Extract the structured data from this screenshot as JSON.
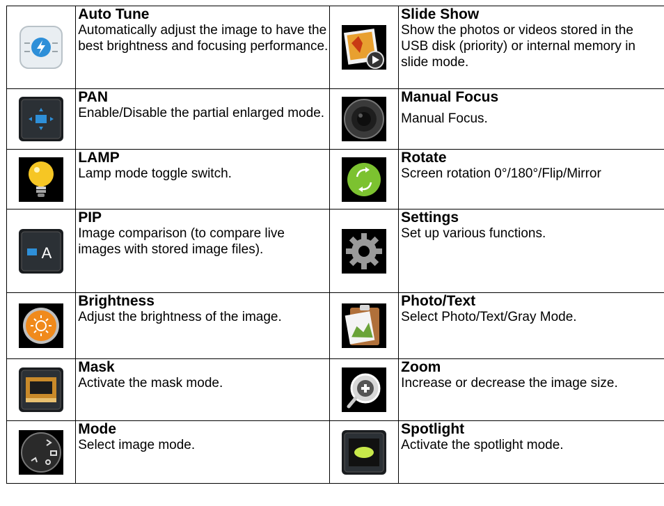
{
  "rows": [
    {
      "left": {
        "icon": "auto-tune-icon",
        "title": "Auto Tune",
        "desc": "Automatically adjust the image to have the best brightness and focusing performance."
      },
      "right": {
        "icon": "slide-show-icon",
        "title": "Slide Show",
        "desc": "Show the photos or videos stored in the USB disk (priority) or internal memory in slide mode."
      }
    },
    {
      "left": {
        "icon": "pan-icon",
        "title": "PAN",
        "desc": "Enable/Disable the partial enlarged mode."
      },
      "right": {
        "icon": "manual-focus-icon",
        "title": "Manual Focus",
        "desc": "Manual Focus."
      }
    },
    {
      "left": {
        "icon": "lamp-icon",
        "title": "LAMP",
        "desc": "Lamp mode toggle switch."
      },
      "right": {
        "icon": "rotate-icon",
        "title": "Rotate",
        "desc": "Screen rotation 0°/180°/Flip/Mirror"
      }
    },
    {
      "left": {
        "icon": "pip-icon",
        "title": "PIP",
        "desc": "Image comparison (to compare live images with stored image files).",
        "icon_text": "A"
      },
      "right": {
        "icon": "settings-icon",
        "title": "Settings",
        "desc": "Set up various functions."
      }
    },
    {
      "left": {
        "icon": "brightness-icon",
        "title": "Brightness",
        "desc": "Adjust the brightness of the image."
      },
      "right": {
        "icon": "photo-text-icon",
        "title": "Photo/Text",
        "desc": "Select Photo/Text/Gray Mode."
      }
    },
    {
      "left": {
        "icon": "mask-icon",
        "title": "Mask",
        "desc": "Activate the mask mode."
      },
      "right": {
        "icon": "zoom-icon",
        "title": "Zoom",
        "desc": "Increase or decrease the image size."
      }
    },
    {
      "left": {
        "icon": "mode-icon",
        "title": "Mode",
        "desc": "Select image mode."
      },
      "right": {
        "icon": "spotlight-icon",
        "title": "Spotlight",
        "desc": "Activate the spotlight mode."
      }
    }
  ]
}
